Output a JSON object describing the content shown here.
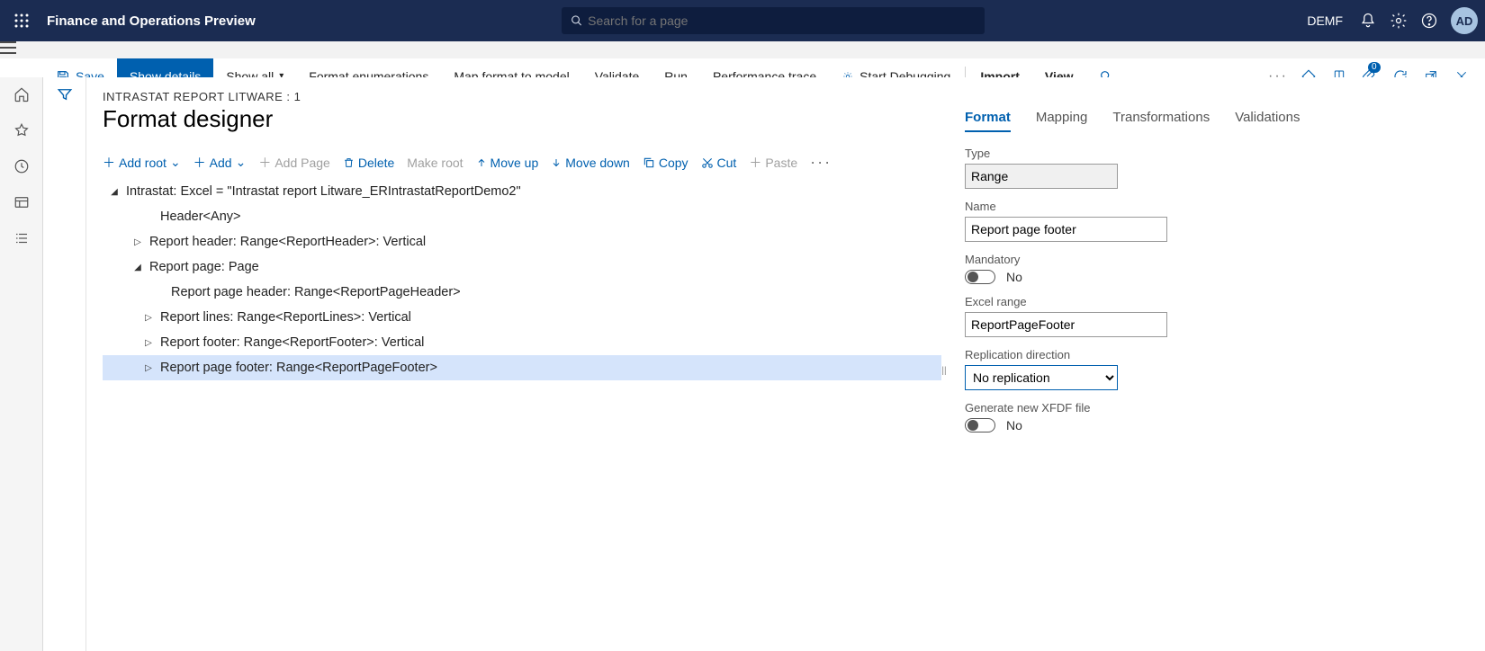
{
  "topbar": {
    "app_title": "Finance and Operations Preview",
    "search_placeholder": "Search for a page",
    "company": "DEMF",
    "avatar": "AD"
  },
  "commandbar": {
    "save": "Save",
    "show_details": "Show details",
    "show_all": "Show all",
    "format_enum": "Format enumerations",
    "map_format": "Map format to model",
    "validate": "Validate",
    "run": "Run",
    "perf_trace": "Performance trace",
    "start_debug": "Start Debugging",
    "import": "Import",
    "view": "View",
    "badge": "0"
  },
  "page": {
    "breadcrumb": "INTRASTAT REPORT LITWARE : 1",
    "title": "Format designer"
  },
  "tree_toolbar": {
    "add_root": "Add root",
    "add": "Add",
    "add_page": "Add Page",
    "delete": "Delete",
    "make_root": "Make root",
    "move_up": "Move up",
    "move_down": "Move down",
    "copy": "Copy",
    "cut": "Cut",
    "paste": "Paste"
  },
  "tree": {
    "n0": "Intrastat: Excel = \"Intrastat report Litware_ERIntrastatReportDemo2\"",
    "n1": "Header<Any>",
    "n2": "Report header: Range<ReportHeader>: Vertical",
    "n3": "Report page: Page",
    "n4": "Report page header: Range<ReportPageHeader>",
    "n5": "Report lines: Range<ReportLines>: Vertical",
    "n6": "Report footer: Range<ReportFooter>: Vertical",
    "n7": "Report page footer: Range<ReportPageFooter>"
  },
  "tabs": {
    "format": "Format",
    "mapping": "Mapping",
    "transformations": "Transformations",
    "validations": "Validations"
  },
  "form": {
    "type_label": "Type",
    "type_value": "Range",
    "name_label": "Name",
    "name_value": "Report page footer",
    "mandatory_label": "Mandatory",
    "mandatory_value": "No",
    "excel_range_label": "Excel range",
    "excel_range_value": "ReportPageFooter",
    "replication_label": "Replication direction",
    "replication_value": "No replication",
    "xfdf_label": "Generate new XFDF file",
    "xfdf_value": "No"
  }
}
